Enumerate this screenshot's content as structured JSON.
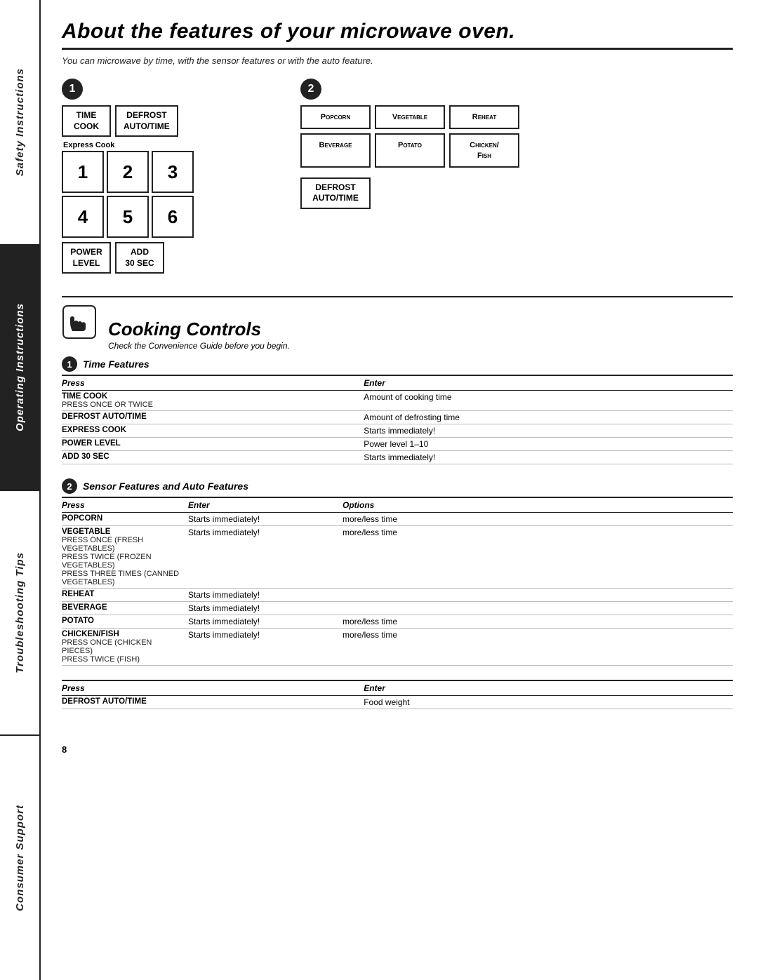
{
  "sidebar": {
    "sections": [
      {
        "label": "Safety Instructions",
        "class": "safety"
      },
      {
        "label": "Operating Instructions",
        "class": "operating"
      },
      {
        "label": "Troubleshooting Tips",
        "class": "troubleshooting"
      },
      {
        "label": "Consumer Support",
        "class": "consumer"
      }
    ]
  },
  "page": {
    "title": "About the features of your microwave oven.",
    "subtitle": "You can microwave by time, with the sensor features or with the auto feature.",
    "badge1": "1",
    "badge2": "2"
  },
  "panel_left": {
    "buttons_top": [
      {
        "label": "Time\nCook"
      },
      {
        "label": "Defrost\nAuto/Time"
      }
    ],
    "express_cook_label": "Express Cook",
    "numbers": [
      "1",
      "2",
      "3",
      "4",
      "5",
      "6"
    ],
    "buttons_bottom": [
      {
        "label": "Power\nLevel"
      },
      {
        "label": "Add\n30 Sec"
      }
    ]
  },
  "panel_right": {
    "buttons_row1": [
      {
        "label": "Popcorn"
      },
      {
        "label": "Vegetable"
      },
      {
        "label": "Reheat"
      }
    ],
    "buttons_row2": [
      {
        "label": "Beverage"
      },
      {
        "label": "Potato"
      },
      {
        "label": "Chicken/\nFish"
      }
    ],
    "defrost_btn": {
      "label": "Defrost\nAuto/Time"
    }
  },
  "cooking_controls": {
    "title": "Cooking Controls",
    "subtitle": "Check the Convenience Guide before you begin."
  },
  "time_features": {
    "title": "Time Features",
    "badge": "1",
    "headers": [
      "Press",
      "Enter"
    ],
    "rows": [
      {
        "press": "TIME COOK",
        "press_sub": "Press once or twice",
        "enter": "Amount of cooking time",
        "options": ""
      },
      {
        "press": "DEFROST AUTO/TIME",
        "press_sub": "",
        "enter": "Amount of defrosting time",
        "options": ""
      },
      {
        "press": "EXPRESS COOK",
        "press_sub": "",
        "enter": "Starts immediately!",
        "options": ""
      },
      {
        "press": "POWER LEVEL",
        "press_sub": "",
        "enter": "Power level 1–10",
        "options": ""
      },
      {
        "press": "ADD 30 SEC",
        "press_sub": "",
        "enter": "Starts immediately!",
        "options": ""
      }
    ]
  },
  "sensor_features": {
    "title": "Sensor Features and Auto Features",
    "badge": "2",
    "headers": [
      "Press",
      "Enter",
      "Options"
    ],
    "rows": [
      {
        "press": "POPCORN",
        "press_sub": "",
        "enter": "Starts immediately!",
        "options": "more/less time"
      },
      {
        "press": "VEGETABLE",
        "press_sub": "Press once (fresh vegetables)\nPress twice (frozen vegetables)\nPress three times (canned vegetables)",
        "enter": "Starts immediately!",
        "options": "more/less time"
      },
      {
        "press": "REHEAT",
        "press_sub": "",
        "enter": "Starts immediately!",
        "options": ""
      },
      {
        "press": "BEVERAGE",
        "press_sub": "",
        "enter": "Starts immediately!",
        "options": ""
      },
      {
        "press": "POTATO",
        "press_sub": "",
        "enter": "Starts immediately!",
        "options": "more/less time"
      },
      {
        "press": "CHICKEN/FISH",
        "press_sub": "Press once (chicken pieces)\nPress twice (fish)",
        "enter": "Starts immediately!",
        "options": "more/less time"
      }
    ]
  },
  "defrost_table": {
    "headers": [
      "Press",
      "Enter"
    ],
    "rows": [
      {
        "press": "DEFROST AUTO/TIME",
        "press_sub": "",
        "enter": "Food weight"
      }
    ]
  },
  "page_number": "8"
}
